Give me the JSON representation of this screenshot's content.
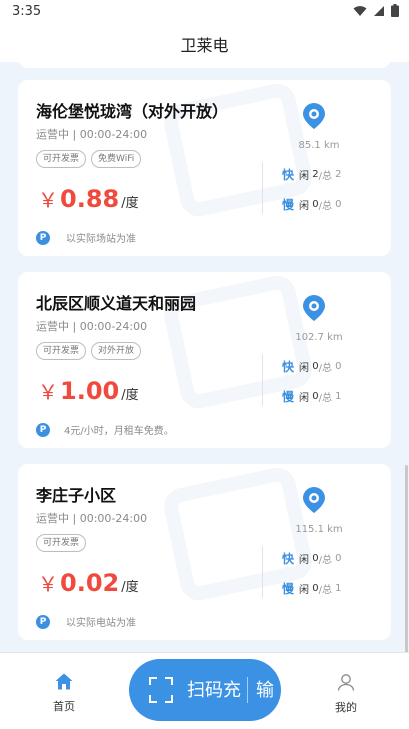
{
  "status": {
    "time": "3:35"
  },
  "header": {
    "title": "卫莱电"
  },
  "stations": [
    {
      "name": "海伦堡悦珑湾（对外开放）",
      "status_label": "运营中",
      "hours": "00:00-24:00",
      "tags": [
        "可开发票",
        "免费WiFi"
      ],
      "currency": "￥",
      "price": "0.88",
      "unit": "/度",
      "note": "以实际场站为准",
      "distance": "85.1 km",
      "fast": {
        "label": "快",
        "idle_label": "闲",
        "idle": "2",
        "total_label": "/总",
        "total": "2"
      },
      "slow": {
        "label": "慢",
        "idle_label": "闲",
        "idle": "0",
        "total_label": "/总",
        "total": "0"
      }
    },
    {
      "name": "北辰区顺义道天和丽园",
      "status_label": "运营中",
      "hours": "00:00-24:00",
      "tags": [
        "可开发票",
        "对外开放"
      ],
      "currency": "￥",
      "price": "1.00",
      "unit": "/度",
      "note": "4元/小时，月租车免费。",
      "distance": "102.7 km",
      "fast": {
        "label": "快",
        "idle_label": "闲",
        "idle": "0",
        "total_label": "/总",
        "total": "0"
      },
      "slow": {
        "label": "慢",
        "idle_label": "闲",
        "idle": "0",
        "total_label": "/总",
        "total": "1"
      }
    },
    {
      "name": "李庄子小区",
      "status_label": "运营中",
      "hours": "00:00-24:00",
      "tags": [
        "可开发票"
      ],
      "currency": "￥",
      "price": "0.02",
      "unit": "/度",
      "note": "以实际电站为准",
      "distance": "115.1 km",
      "fast": {
        "label": "快",
        "idle_label": "闲",
        "idle": "0",
        "total_label": "/总",
        "total": "0"
      },
      "slow": {
        "label": "慢",
        "idle_label": "闲",
        "idle": "0",
        "total_label": "/总",
        "total": "1"
      }
    }
  ],
  "parking_badge": "P",
  "nav": {
    "home": "首页",
    "scan": "扫码充",
    "scan_extra": "输",
    "mine": "我的"
  },
  "colors": {
    "accent": "#3b91e3",
    "price": "#f04a3e"
  },
  "icons": {
    "location": "location-pin-icon",
    "home": "home-icon",
    "scan": "scan-frame-icon",
    "user": "user-icon"
  }
}
